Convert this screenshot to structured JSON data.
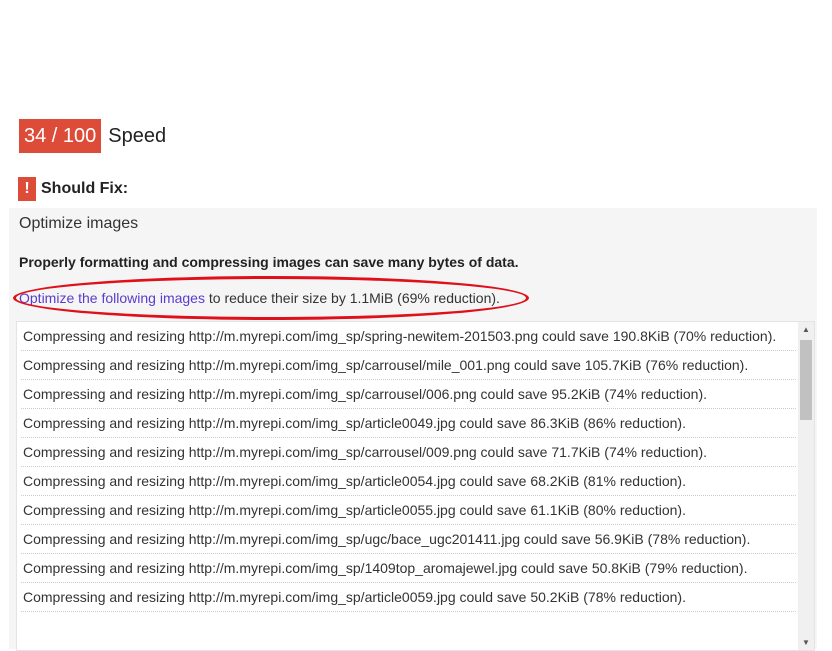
{
  "score": {
    "value": "34 / 100",
    "label": "Speed"
  },
  "section": {
    "icon": "!",
    "heading": "Should Fix:"
  },
  "rule": {
    "title": "Optimize images",
    "summary": "Properly formatting and compressing images can save many bytes of data.",
    "detail_link": "Optimize the following images",
    "detail_rest": " to reduce their size by 1.1MiB (69% reduction)."
  },
  "items": [
    "Compressing and resizing http://m.myrepi.com/img_sp/spring-newitem-201503.png could save 190.8KiB (70% reduction).",
    "Compressing and resizing http://m.myrepi.com/img_sp/carrousel/mile_001.png could save 105.7KiB (76% reduction).",
    "Compressing and resizing http://m.myrepi.com/img_sp/carrousel/006.png could save 95.2KiB (74% reduction).",
    "Compressing and resizing http://m.myrepi.com/img_sp/article0049.jpg could save 86.3KiB (86% reduction).",
    "Compressing and resizing http://m.myrepi.com/img_sp/carrousel/009.png could save 71.7KiB (74% reduction).",
    "Compressing and resizing http://m.myrepi.com/img_sp/article0054.jpg could save 68.2KiB (81% reduction).",
    "Compressing and resizing http://m.myrepi.com/img_sp/article0055.jpg could save 61.1KiB (80% reduction).",
    "Compressing and resizing http://m.myrepi.com/img_sp/ugc/bace_ugc201411.jpg could save 56.9KiB (78% reduction).",
    "Compressing and resizing http://m.myrepi.com/img_sp/1409top_aromajewel.jpg could save 50.8KiB (79% reduction).",
    "Compressing and resizing http://m.myrepi.com/img_sp/article0059.jpg could save 50.2KiB (78% reduction)."
  ],
  "scrollbar": {
    "up_icon": "▲",
    "down_icon": "▼"
  }
}
